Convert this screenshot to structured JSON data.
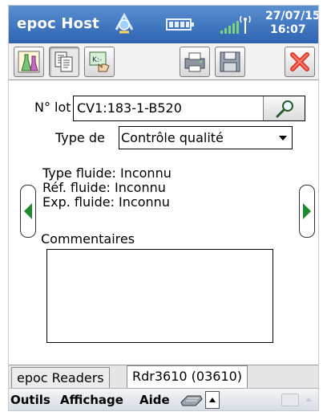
{
  "window": {
    "title": "epoc Host",
    "date": "27/07/15",
    "time": "16:07"
  },
  "toolbar": {
    "buttons": [
      {
        "icon": "lab-flasks-icon",
        "active": false
      },
      {
        "icon": "documents-icon",
        "active": true
      },
      {
        "icon": "keypad-hand-icon",
        "active": false
      },
      {
        "icon": "printer-icon",
        "active": false
      },
      {
        "icon": "save-disk-icon",
        "active": false
      },
      {
        "icon": "close-x-icon",
        "active": false
      }
    ]
  },
  "form": {
    "lot_label": "N° lot",
    "lot_value": "CV1:183-1-B520",
    "type_label": "Type de",
    "type_value": "Contrôle qualité",
    "fluid_type": "Type fluide: Inconnu",
    "fluid_ref": "Réf. fluide: Inconnu",
    "fluid_exp": "Exp. fluide: Inconnu",
    "comments_label": "Commentaires",
    "comments_value": ""
  },
  "tabs": [
    {
      "label": "epoc Readers",
      "selected": false
    },
    {
      "label": "Rdr3610 (03610)",
      "selected": true
    }
  ],
  "menubar": {
    "tools": "Outils",
    "view": "Affichage",
    "help": "Aide"
  },
  "colors": {
    "titlebar": "#2d63b2",
    "arrow_green": "#1f8a2e",
    "close_red": "#e03a2a"
  }
}
